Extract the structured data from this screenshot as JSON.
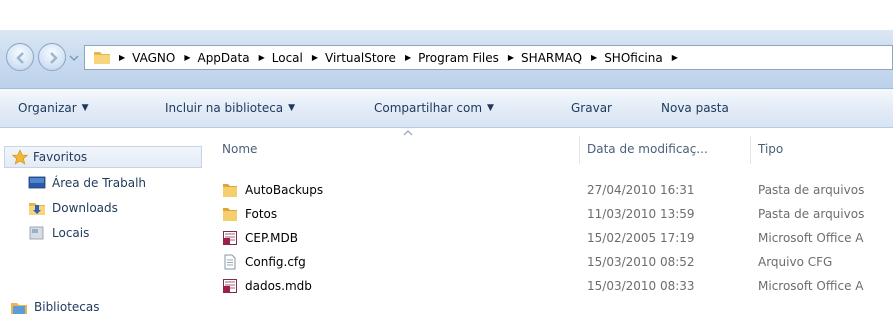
{
  "address_bar": {
    "breadcrumbs": [
      "VAGNO",
      "AppData",
      "Local",
      "VirtualStore",
      "Program Files",
      "SHARMAQ",
      "SHOficina"
    ]
  },
  "toolbar": {
    "organize_label": "Organizar",
    "include_library_label": "Incluir na biblioteca",
    "share_label": "Compartilhar com",
    "burn_label": "Gravar",
    "new_folder_label": "Nova pasta"
  },
  "nav_pane": {
    "favorites_label": "Favoritos",
    "desktop_label": "Área de Trabalh",
    "downloads_label": "Downloads",
    "recent_label": "Locais",
    "libraries_label": "Bibliotecas"
  },
  "columns": {
    "name": "Nome",
    "date_modified": "Data de modificaç...",
    "type": "Tipo"
  },
  "files": [
    {
      "name": "AutoBackups",
      "date": "27/04/2010 16:31",
      "type": "Pasta de arquivos",
      "icon": "folder-icon"
    },
    {
      "name": "Fotos",
      "date": "11/03/2010 13:59",
      "type": "Pasta de arquivos",
      "icon": "folder-icon"
    },
    {
      "name": "CEP.MDB",
      "date": "15/02/2005 17:19",
      "type": "Microsoft Office A",
      "icon": "access-db-icon"
    },
    {
      "name": "Config.cfg",
      "date": "15/03/2010 08:52",
      "type": "Arquivo CFG",
      "icon": "text-file-icon"
    },
    {
      "name": "dados.mdb",
      "date": "15/03/2010 08:33",
      "type": "Microsoft Office A",
      "icon": "access-db-icon"
    }
  ]
}
